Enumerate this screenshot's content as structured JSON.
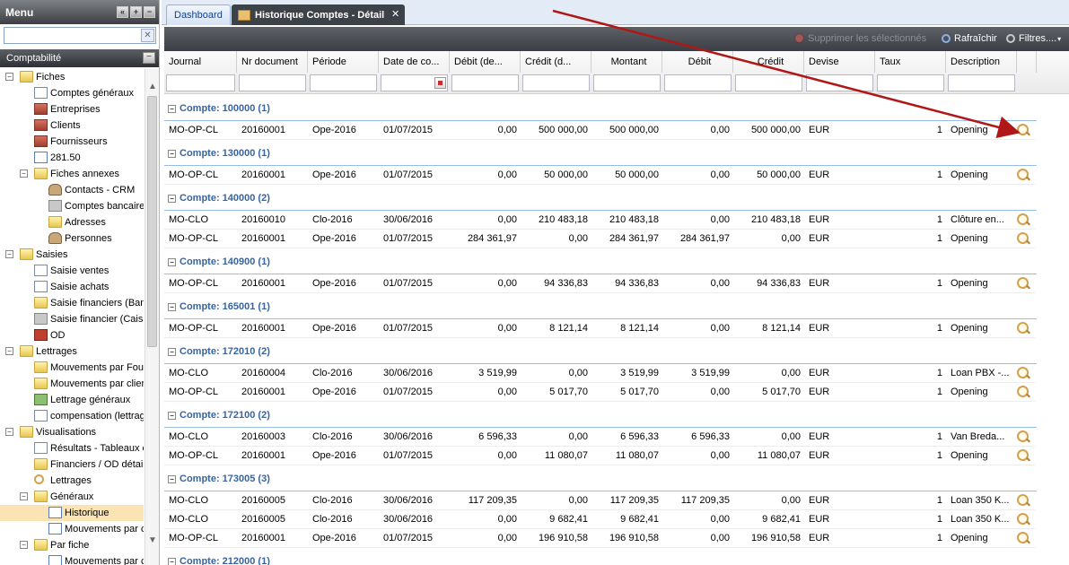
{
  "sidebar": {
    "title": "Menu",
    "search_value": "",
    "section": "Comptabilité",
    "tree": [
      {
        "label": "Fiches",
        "level": 0,
        "icon": "folder",
        "toggle": "−"
      },
      {
        "label": "Comptes généraux",
        "level": 1,
        "icon": "doc"
      },
      {
        "label": "Entreprises",
        "level": 1,
        "icon": "house"
      },
      {
        "label": "Clients",
        "level": 1,
        "icon": "house"
      },
      {
        "label": "Fournisseurs",
        "level": 1,
        "icon": "house"
      },
      {
        "label": "281.50",
        "level": 1,
        "icon": "card"
      },
      {
        "label": "Fiches annexes",
        "level": 1,
        "icon": "folder",
        "toggle": "−"
      },
      {
        "label": "Contacts - CRM",
        "level": 2,
        "icon": "users"
      },
      {
        "label": "Comptes bancaire",
        "level": 2,
        "icon": "gray"
      },
      {
        "label": "Adresses",
        "level": 2,
        "icon": "folder"
      },
      {
        "label": "Personnes",
        "level": 2,
        "icon": "users"
      },
      {
        "label": "Saisies",
        "level": 0,
        "icon": "folder",
        "toggle": "−"
      },
      {
        "label": "Saisie ventes",
        "level": 1,
        "icon": "doc"
      },
      {
        "label": "Saisie achats",
        "level": 1,
        "icon": "doc"
      },
      {
        "label": "Saisie financiers (Ban",
        "level": 1,
        "icon": "folder"
      },
      {
        "label": "Saisie financier (Caiss",
        "level": 1,
        "icon": "gray"
      },
      {
        "label": "OD",
        "level": 1,
        "icon": "red"
      },
      {
        "label": "Lettrages",
        "level": 0,
        "icon": "folder",
        "toggle": "−"
      },
      {
        "label": "Mouvements par Four",
        "level": 1,
        "icon": "folder"
      },
      {
        "label": "Mouvements par clien",
        "level": 1,
        "icon": "folder"
      },
      {
        "label": "Lettrage généraux",
        "level": 1,
        "icon": "green"
      },
      {
        "label": "compensation (lettrag",
        "level": 1,
        "icon": "doc"
      },
      {
        "label": "Visualisations",
        "level": 0,
        "icon": "folder",
        "toggle": "−"
      },
      {
        "label": "Résultats - Tableaux c",
        "level": 1,
        "icon": "doc"
      },
      {
        "label": "Financiers / OD détail",
        "level": 1,
        "icon": "folder"
      },
      {
        "label": "Lettrages",
        "level": 1,
        "icon": "mag"
      },
      {
        "label": "Généraux",
        "level": 1,
        "icon": "folder",
        "toggle": "−"
      },
      {
        "label": "Historique",
        "level": 2,
        "icon": "card",
        "selected": true
      },
      {
        "label": "Mouvements par c",
        "level": 2,
        "icon": "card"
      },
      {
        "label": "Par fiche",
        "level": 1,
        "icon": "folder",
        "toggle": "−"
      },
      {
        "label": "Mouvements par c",
        "level": 2,
        "icon": "card"
      }
    ]
  },
  "tabs": [
    {
      "label": "Dashboard",
      "active": false
    },
    {
      "label": "Historique Comptes - Détail",
      "active": true
    }
  ],
  "toolbar": {
    "delete_label": "Supprimer les sélectionnés",
    "refresh_label": "Rafraîchir",
    "filters_label": "Filtres...."
  },
  "columns": [
    "Journal",
    "Nr document",
    "Période",
    "Date de co...",
    "Débit (de...",
    "Crédit (d...",
    "Montant",
    "Débit",
    "Crédit",
    "Devise",
    "Taux",
    "Description"
  ],
  "groups": [
    {
      "title": "Compte: 100000 (1)",
      "rows": [
        [
          "MO-OP-CL",
          "20160001",
          "Ope-2016",
          "01/07/2015",
          "0,00",
          "500 000,00",
          "500 000,00",
          "0,00",
          "500 000,00",
          "EUR",
          "1",
          "Opening"
        ]
      ]
    },
    {
      "title": "Compte: 130000 (1)",
      "rows": [
        [
          "MO-OP-CL",
          "20160001",
          "Ope-2016",
          "01/07/2015",
          "0,00",
          "50 000,00",
          "50 000,00",
          "0,00",
          "50 000,00",
          "EUR",
          "1",
          "Opening"
        ]
      ]
    },
    {
      "title": "Compte: 140000 (2)",
      "rows": [
        [
          "MO-CLO",
          "20160010",
          "Clo-2016",
          "30/06/2016",
          "0,00",
          "210 483,18",
          "210 483,18",
          "0,00",
          "210 483,18",
          "EUR",
          "1",
          "Clôture en..."
        ],
        [
          "MO-OP-CL",
          "20160001",
          "Ope-2016",
          "01/07/2015",
          "284 361,97",
          "0,00",
          "284 361,97",
          "284 361,97",
          "0,00",
          "EUR",
          "1",
          "Opening"
        ]
      ]
    },
    {
      "title": "Compte: 140900 (1)",
      "rows": [
        [
          "MO-OP-CL",
          "20160001",
          "Ope-2016",
          "01/07/2015",
          "0,00",
          "94 336,83",
          "94 336,83",
          "0,00",
          "94 336,83",
          "EUR",
          "1",
          "Opening"
        ]
      ]
    },
    {
      "title": "Compte: 165001 (1)",
      "rows": [
        [
          "MO-OP-CL",
          "20160001",
          "Ope-2016",
          "01/07/2015",
          "0,00",
          "8 121,14",
          "8 121,14",
          "0,00",
          "8 121,14",
          "EUR",
          "1",
          "Opening"
        ]
      ]
    },
    {
      "title": "Compte: 172010 (2)",
      "rows": [
        [
          "MO-CLO",
          "20160004",
          "Clo-2016",
          "30/06/2016",
          "3 519,99",
          "0,00",
          "3 519,99",
          "3 519,99",
          "0,00",
          "EUR",
          "1",
          "Loan PBX -..."
        ],
        [
          "MO-OP-CL",
          "20160001",
          "Ope-2016",
          "01/07/2015",
          "0,00",
          "5 017,70",
          "5 017,70",
          "0,00",
          "5 017,70",
          "EUR",
          "1",
          "Opening"
        ]
      ]
    },
    {
      "title": "Compte: 172100 (2)",
      "rows": [
        [
          "MO-CLO",
          "20160003",
          "Clo-2016",
          "30/06/2016",
          "6 596,33",
          "0,00",
          "6 596,33",
          "6 596,33",
          "0,00",
          "EUR",
          "1",
          "Van Breda..."
        ],
        [
          "MO-OP-CL",
          "20160001",
          "Ope-2016",
          "01/07/2015",
          "0,00",
          "11 080,07",
          "11 080,07",
          "0,00",
          "11 080,07",
          "EUR",
          "1",
          "Opening"
        ]
      ]
    },
    {
      "title": "Compte: 173005 (3)",
      "rows": [
        [
          "MO-CLO",
          "20160005",
          "Clo-2016",
          "30/06/2016",
          "117 209,35",
          "0,00",
          "117 209,35",
          "117 209,35",
          "0,00",
          "EUR",
          "1",
          "Loan 350 K..."
        ],
        [
          "MO-CLO",
          "20160005",
          "Clo-2016",
          "30/06/2016",
          "0,00",
          "9 682,41",
          "9 682,41",
          "0,00",
          "9 682,41",
          "EUR",
          "1",
          "Loan 350 K..."
        ],
        [
          "MO-OP-CL",
          "20160001",
          "Ope-2016",
          "01/07/2015",
          "0,00",
          "196 910,58",
          "196 910,58",
          "0,00",
          "196 910,58",
          "EUR",
          "1",
          "Opening"
        ]
      ]
    },
    {
      "title": "Compte: 212000 (1)",
      "rows": []
    }
  ],
  "colors": {
    "accent": "#3764a0",
    "arrow": "#b01818",
    "toolbar": "#4a4d54"
  }
}
